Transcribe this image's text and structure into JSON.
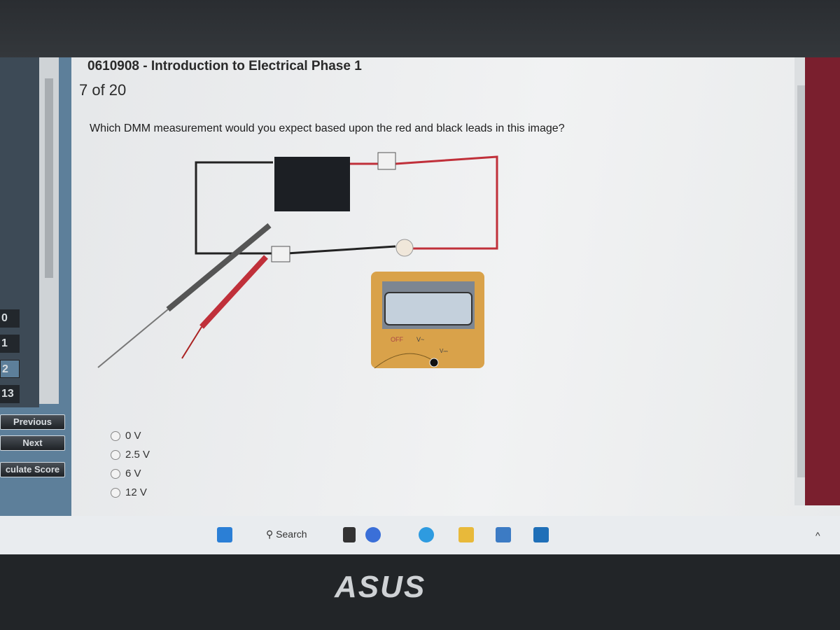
{
  "course_title": "0610908 - Introduction to Electrical Phase 1",
  "counter": "7 of 20",
  "question": "Which DMM measurement would you expect based upon the red and black leads in this image?",
  "sidebar": {
    "question_numbers": [
      "0",
      "1",
      "2",
      "13"
    ],
    "selected_index": 2,
    "buttons": {
      "previous": "Previous",
      "next": "Next",
      "score": "culate Score"
    }
  },
  "options": [
    "0 V",
    "2.5 V",
    "6 V",
    "12 V"
  ],
  "meter": {
    "off": "OFF",
    "vac": "V~",
    "vdc": "V⎓"
  },
  "taskbar": {
    "search": "Search"
  },
  "brand": "ASUS",
  "colors": {
    "sidebar": "#5d7f9a",
    "wire_red": "#c0303a",
    "meter_body": "#d9a24a"
  }
}
